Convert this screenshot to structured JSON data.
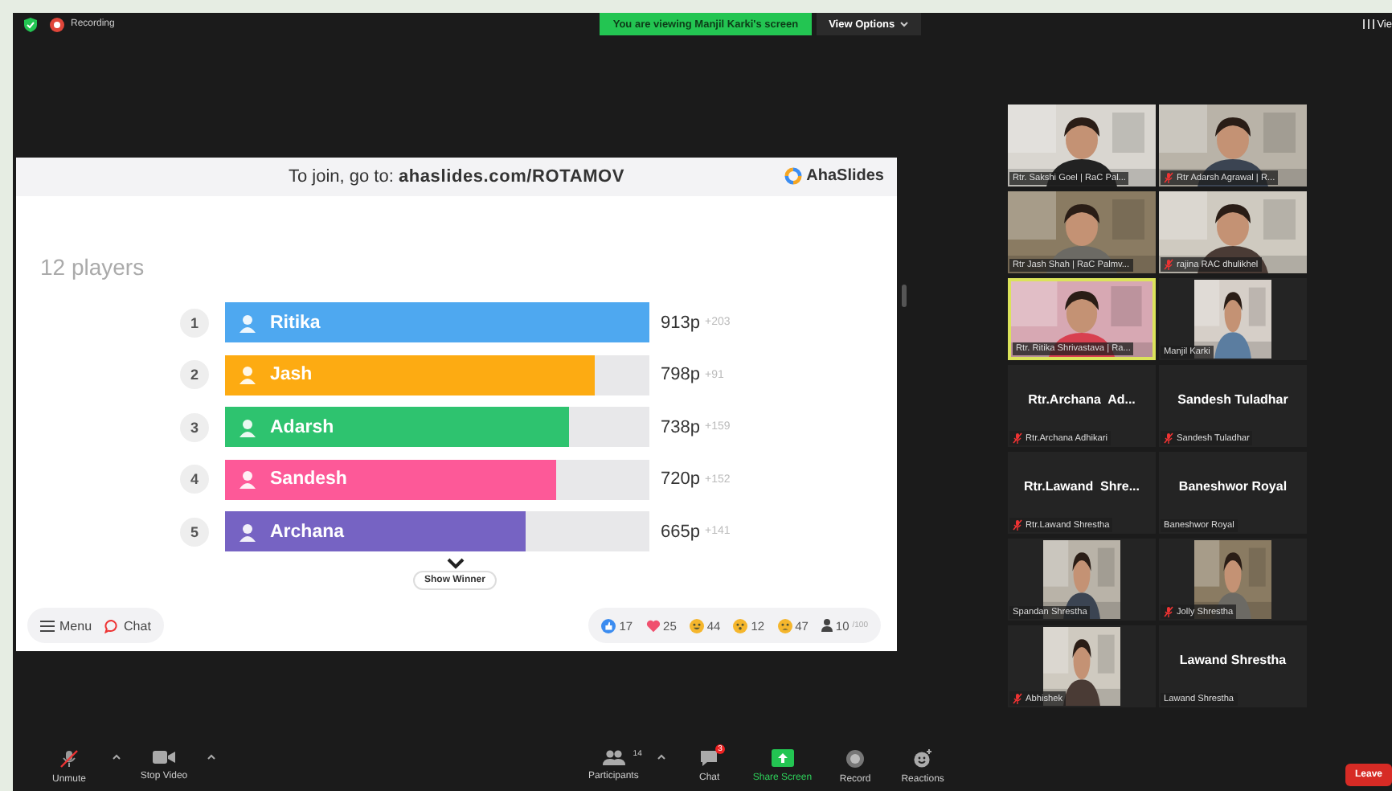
{
  "top_bar": {
    "recording": "Recording",
    "banner": "You are viewing Manjil Karki's screen",
    "view_options": "View Options",
    "view": "Vie"
  },
  "slide": {
    "join": "To join, go to: **ahaslides.com/ROTAMOV**",
    "logo": "AhaSlides",
    "players": "12 players",
    "leaderboard": [
      {
        "rank": "1",
        "name": "Ritika",
        "points": "913p",
        "delta": "+203",
        "level": 1,
        "color": "#4ea8f0"
      },
      {
        "rank": "2",
        "name": "Jash",
        "points": "798p",
        "delta": "+91",
        "level": 0.87,
        "color": "#fdab12"
      },
      {
        "rank": "3",
        "name": "Adarsh",
        "points": "738p",
        "delta": "+159",
        "level": 0.81,
        "color": "#2ec36f"
      },
      {
        "rank": "4",
        "name": "Sandesh",
        "points": "720p",
        "delta": "+152",
        "level": 0.78,
        "color": "#fd5998"
      },
      {
        "rank": "5",
        "name": "Archana",
        "points": "665p",
        "delta": "+141",
        "level": 0.71,
        "color": "#7663c3"
      }
    ],
    "show_winner": "Show Winner",
    "menu": "Menu",
    "chat": "Chat",
    "reactions": [
      {
        "kind": "like",
        "count": "17"
      },
      {
        "kind": "heart",
        "count": "25"
      },
      {
        "kind": "laugh",
        "count": "44"
      },
      {
        "kind": "wow",
        "count": "12"
      },
      {
        "kind": "sad",
        "count": "47"
      }
    ],
    "audience": {
      "count": "10",
      "limit": "/100"
    }
  },
  "participants": [
    {
      "kind": "video",
      "label": "Rtr. Sakshi Goel | RaC Pal...",
      "muted": false,
      "speaking": false
    },
    {
      "kind": "video",
      "label": "Rtr Adarsh Agrawal | R...",
      "muted": true,
      "speaking": false
    },
    {
      "kind": "video",
      "label": "Rtr Jash Shah | RaC Palmv...",
      "muted": false,
      "speaking": false
    },
    {
      "kind": "video",
      "label": "rajina RAC dhulikhel",
      "muted": true,
      "speaking": false
    },
    {
      "kind": "video",
      "label": "Rtr. Ritika Shrivastava | Ra...",
      "muted": false,
      "speaking": true
    },
    {
      "label": "Manjil Karki",
      "muted": false,
      "speaking": false
    },
    {
      "kind": "name",
      "title": "Rtr.Archana  Ad...",
      "label": "Rtr.Archana Adhikari",
      "muted": true,
      "speaking": false
    },
    {
      "kind": "name",
      "title": "Sandesh Tuladhar",
      "label": "Sandesh Tuladhar",
      "muted": true,
      "speaking": false
    },
    {
      "kind": "name",
      "title": "Rtr.Lawand  Shre...",
      "label": "Rtr.Lawand Shrestha",
      "muted": true,
      "speaking": false
    },
    {
      "kind": "name",
      "title": "Baneshwor Royal",
      "label": "Baneshwor Royal",
      "muted": false,
      "speaking": false
    },
    {
      "label": "Spandan Shrestha",
      "muted": false,
      "speaking": false
    },
    {
      "label": "Jolly Shrestha",
      "muted": true,
      "speaking": false
    },
    {
      "label": "Abhishek",
      "muted": true,
      "speaking": false
    },
    {
      "kind": "name",
      "title": "Lawand Shrestha",
      "label": "Lawand Shrestha",
      "muted": false,
      "speaking": false
    }
  ],
  "toolbar": [
    {
      "kind": "mic",
      "label": "Unmute",
      "muted": true
    },
    {
      "kind": "video",
      "label": "Stop Video"
    },
    {
      "kind": "participants",
      "label": "Participants",
      "count": "14"
    },
    {
      "kind": "chat",
      "label": "Chat",
      "badge": "3"
    },
    {
      "kind": "share",
      "label": "Share Screen"
    },
    {
      "kind": "record",
      "label": "Record"
    },
    {
      "kind": "reactions",
      "label": "Reactions"
    }
  ],
  "leave": "Leave"
}
